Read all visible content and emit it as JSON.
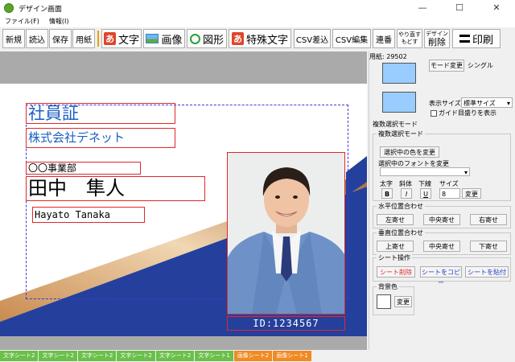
{
  "window": {
    "title": "デザイン画面",
    "min": "—",
    "max": "☐",
    "close": "✕"
  },
  "menu": [
    "ファイル(F)",
    "情報(I)"
  ],
  "toolbar": {
    "new": "新規",
    "open": "読込",
    "save": "保存",
    "paper": "用紙",
    "text": "文字",
    "image": "画像",
    "shape": "図形",
    "special": "特殊文字",
    "csv_merge": "CSV差込",
    "csv_edit": "CSV編集",
    "serial": "連番",
    "redo_top": "やり直す",
    "redo_bottom": "もどす",
    "delete_top": "デザイン",
    "delete_bottom": "削除",
    "print": "印刷",
    "text_icon": "あ"
  },
  "card": {
    "title": "社員証",
    "company": "株式会社デネット",
    "dept": "〇〇事業部",
    "name": "田中　隼人",
    "romaji": "Hayato Tanaka",
    "id": "ID:1234567"
  },
  "panel": {
    "paper_label": "用紙: 29502",
    "mode_change": "モード変更",
    "mode_value": "シングル",
    "display_size_label": "表示サイズ",
    "display_size_value": "標準サイズ",
    "guide_label": "ガイド目盛りを表示",
    "multi_mode": "複数選択モード",
    "multi_group": "複数選択モード",
    "change_color": "選択中の色を変更",
    "change_font": "選択中のフォントを変更",
    "bold": "太字",
    "italic": "斜体",
    "underline": "下線",
    "size": "サイズ",
    "b": "B",
    "i": "I",
    "u": "U",
    "size_value": "8",
    "size_change": "変更",
    "halign_group": "水平位置合わせ",
    "left_align": "左寄せ",
    "center_align": "中央寄せ",
    "right_align": "右寄せ",
    "valign_group": "垂直位置合わせ",
    "top_align": "上寄せ",
    "middle_align": "中央寄せ",
    "bottom_align": "下寄せ",
    "sheet_group": "シート操作",
    "sheet_delete": "シート削除",
    "sheet_copy": "シートをコピー",
    "sheet_paste": "シートを貼付",
    "bg_group": "背景色",
    "bg_change": "変更"
  },
  "tabs": [
    {
      "label": "文字シート2",
      "kind": "g"
    },
    {
      "label": "文字シート2",
      "kind": "g"
    },
    {
      "label": "文字シート2",
      "kind": "g"
    },
    {
      "label": "文字シート2",
      "kind": "g"
    },
    {
      "label": "文字シート2",
      "kind": "g"
    },
    {
      "label": "文字シート1",
      "kind": "g"
    },
    {
      "label": "画像シート2",
      "kind": "o"
    },
    {
      "label": "画像シート1",
      "kind": "o"
    }
  ],
  "colors": {
    "accent_blue": "#1a5fc0",
    "card_navy": "#24409c",
    "frame_red": "#e0282b",
    "swatch": "#99ccff"
  }
}
